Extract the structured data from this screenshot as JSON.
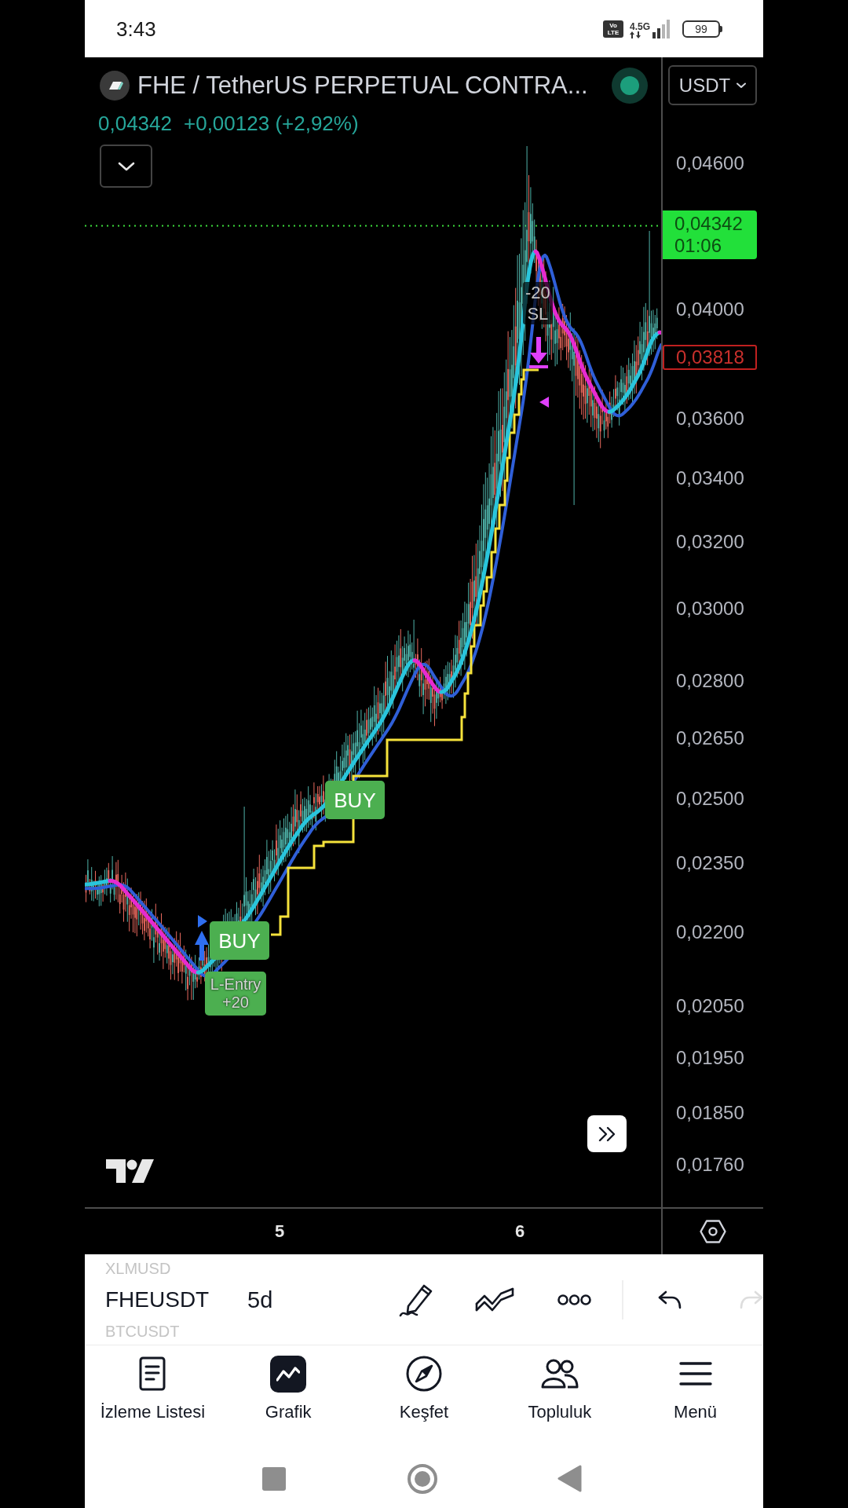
{
  "status_bar": {
    "time": "3:43",
    "network_badge": [
      "Vo",
      "LTE"
    ],
    "network_type": "4.5G",
    "battery": "99"
  },
  "header": {
    "title": "FHE / TetherUS PERPETUAL CONTRA...",
    "currency": "USDT",
    "price": "0,04342",
    "change": "+0,00123 (+2,92%)"
  },
  "chart": {
    "markers": [
      {
        "kind": "exit",
        "lines": [
          "-20",
          "SL"
        ]
      },
      {
        "kind": "buy",
        "lines": [
          "BUY"
        ]
      },
      {
        "kind": "buy",
        "lines": [
          "BUY"
        ]
      },
      {
        "kind": "entry",
        "lines": [
          "L-Entry",
          "+20"
        ]
      }
    ]
  },
  "price_axis": {
    "ticks": [
      "0,04600",
      "0,04000",
      "0,03600",
      "0,03400",
      "0,03200",
      "0,03000",
      "0,02800",
      "0,02650",
      "0,02500",
      "0,02350",
      "0,02200",
      "0,02050",
      "0,01950",
      "0,01850",
      "0,01760"
    ],
    "last_price": {
      "price": "0,04342",
      "countdown": "01:06"
    },
    "stop_price": "0,03818"
  },
  "time_axis": {
    "labels": [
      "5",
      "6"
    ]
  },
  "toolbar": {
    "symbols": [
      {
        "text": "XLMUSD",
        "selected": false
      },
      {
        "text": "FHEUSDT",
        "selected": true
      },
      {
        "text": "BTCUSDT",
        "selected": false
      }
    ],
    "interval": "5d",
    "redo_disabled": true
  },
  "bottom_nav": [
    {
      "label": "İzleme Listesi",
      "selected": false
    },
    {
      "label": "Grafik",
      "selected": true
    },
    {
      "label": "Keşfet",
      "selected": false
    },
    {
      "label": "Topluluk",
      "selected": false
    },
    {
      "label": "Menü",
      "selected": false
    }
  ]
}
